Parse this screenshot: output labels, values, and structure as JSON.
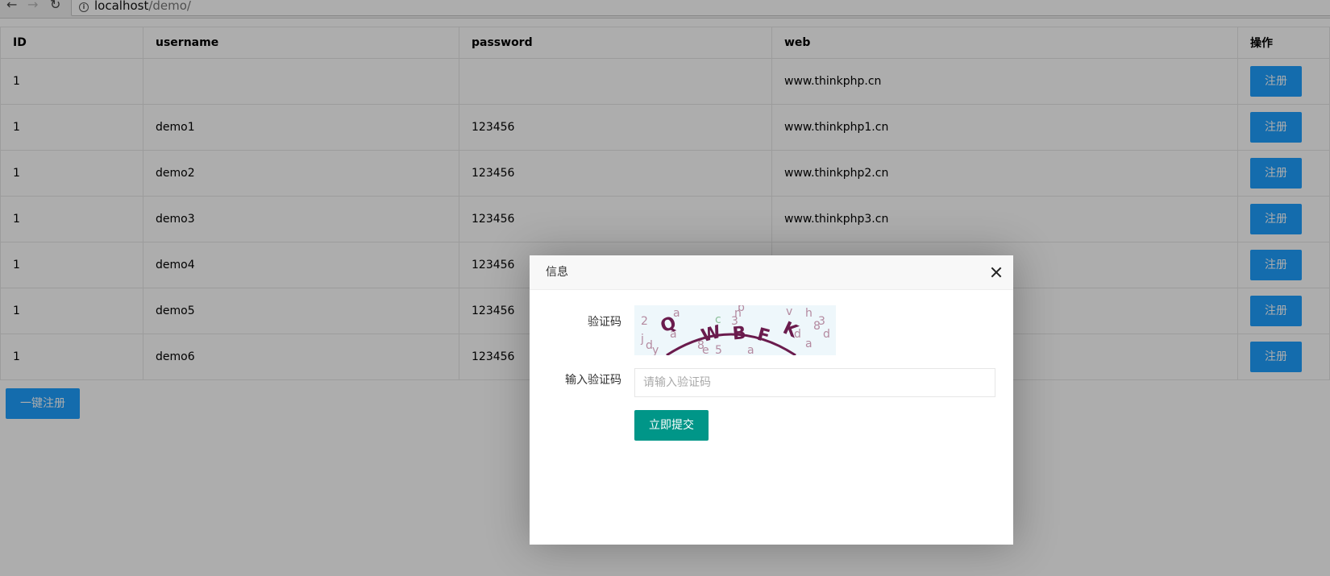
{
  "browser": {
    "url_host": "localhost",
    "url_path": "/demo/"
  },
  "table": {
    "headers": [
      "ID",
      "username",
      "password",
      "web",
      "操作"
    ],
    "rows": [
      {
        "id": "1",
        "username": "",
        "password": "",
        "web": "www.thinkphp.cn",
        "action": "注册"
      },
      {
        "id": "1",
        "username": "demo1",
        "password": "123456",
        "web": "www.thinkphp1.cn",
        "action": "注册"
      },
      {
        "id": "1",
        "username": "demo2",
        "password": "123456",
        "web": "www.thinkphp2.cn",
        "action": "注册"
      },
      {
        "id": "1",
        "username": "demo3",
        "password": "123456",
        "web": "www.thinkphp3.cn",
        "action": "注册"
      },
      {
        "id": "1",
        "username": "demo4",
        "password": "123456",
        "web": "",
        "action": "注册"
      },
      {
        "id": "1",
        "username": "demo5",
        "password": "123456",
        "web": "",
        "action": "注册"
      },
      {
        "id": "1",
        "username": "demo6",
        "password": "123456",
        "web": "",
        "action": "注册"
      }
    ]
  },
  "bulk_register_label": "一键注册",
  "dialog": {
    "title": "信息",
    "captcha_label": "验证码",
    "captcha_text": "QWBFK",
    "input_label": "输入验证码",
    "input_placeholder": "请输入验证码",
    "input_value": "",
    "submit_label": "立即提交"
  },
  "colors": {
    "primary_button": "#1e9fff",
    "submit_button": "#009688",
    "captcha_glyph": "#6a1b4d"
  }
}
